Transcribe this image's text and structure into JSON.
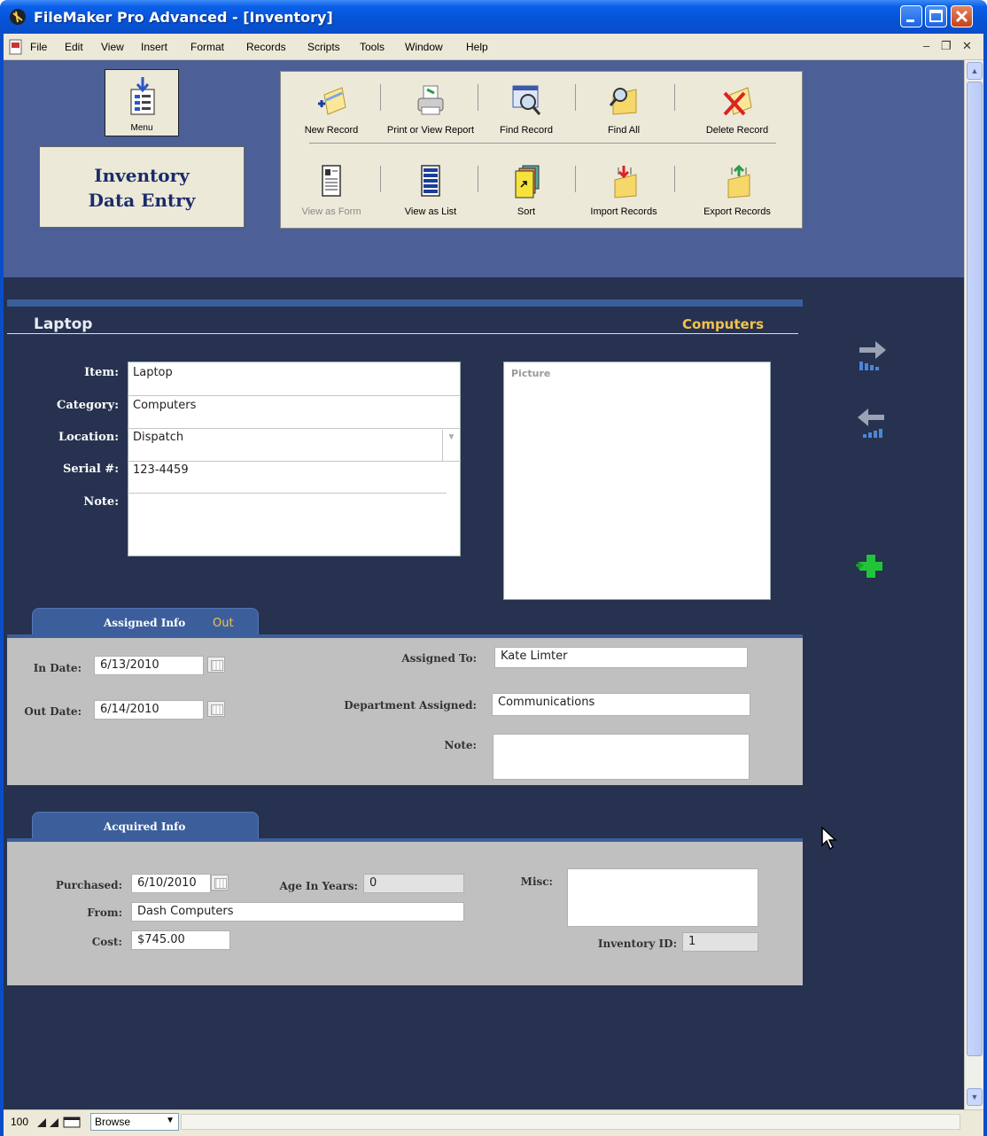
{
  "window": {
    "title": "FileMaker Pro Advanced - [Inventory]"
  },
  "menu": {
    "items": [
      "File",
      "Edit",
      "View",
      "Insert",
      "Format",
      "Records",
      "Scripts",
      "Tools",
      "Window",
      "Help"
    ]
  },
  "header": {
    "menu_button_label": "Menu",
    "title_line1": "Inventory",
    "title_line2": "Data Entry"
  },
  "toolbar": {
    "row1": [
      {
        "label": "New Record",
        "icon": "new-record-icon"
      },
      {
        "label": "Print or View Report",
        "icon": "printer-icon"
      },
      {
        "label": "Find Record",
        "icon": "find-record-icon"
      },
      {
        "label": "Find All",
        "icon": "find-all-icon"
      },
      {
        "label": "Delete Record",
        "icon": "delete-record-icon"
      }
    ],
    "row2": [
      {
        "label": "View as Form",
        "icon": "form-view-icon",
        "disabled": true
      },
      {
        "label": "View as List",
        "icon": "list-view-icon"
      },
      {
        "label": "Sort",
        "icon": "sort-icon"
      },
      {
        "label": "Import Records",
        "icon": "import-icon"
      },
      {
        "label": "Export Records",
        "icon": "export-icon"
      }
    ]
  },
  "record": {
    "title": "Laptop",
    "category_heading": "Computers",
    "labels": {
      "item": "Item:",
      "category": "Category:",
      "location": "Location:",
      "serial": "Serial #:",
      "note": "Note:"
    },
    "values": {
      "item": "Laptop",
      "category": "Computers",
      "location": "Dispatch",
      "serial": "123-4459",
      "note": ""
    },
    "picture_label": "Picture"
  },
  "assigned": {
    "tab_label": "Assigned Info",
    "status": "Out",
    "labels": {
      "in_date": "In Date:",
      "out_date": "Out Date:",
      "assigned_to": "Assigned To:",
      "department": "Department Assigned:",
      "note": "Note:"
    },
    "values": {
      "in_date": "6/13/2010",
      "out_date": "6/14/2010",
      "assigned_to": "Kate Limter",
      "department": "Communications",
      "note": ""
    }
  },
  "acquired": {
    "tab_label": "Acquired Info",
    "labels": {
      "purchased": "Purchased:",
      "age": "Age In Years:",
      "misc": "Misc:",
      "from": "From:",
      "cost": "Cost:",
      "inventory_id": "Inventory ID:"
    },
    "values": {
      "purchased": "6/10/2010",
      "age": "0",
      "misc": "",
      "from": "Dash Computers",
      "cost": "$745.00",
      "inventory_id": "1"
    }
  },
  "statusbar": {
    "zoom": "100",
    "mode": "Browse"
  },
  "colors": {
    "background": "#26324f",
    "header_band": "#4c5f97",
    "tab_blue": "#3c5f9c",
    "accent_gold": "#f3c24c",
    "panel_gray": "#c0c0c0"
  }
}
